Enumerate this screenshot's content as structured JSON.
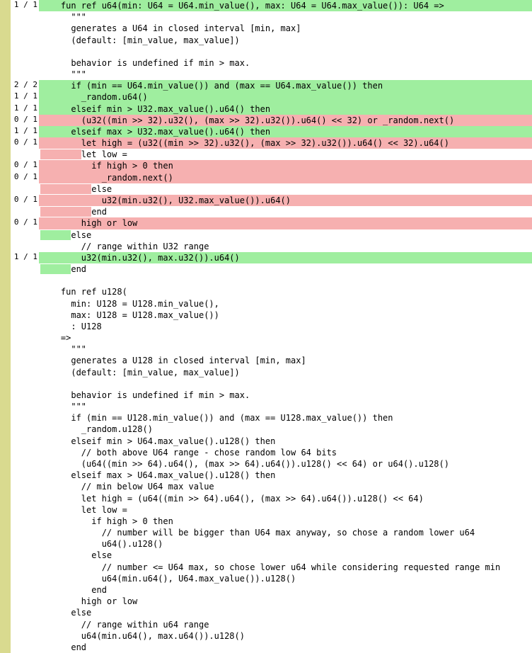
{
  "lines": [
    {
      "cov": "1 / 1",
      "hl": "green",
      "text": "    fun ref u64(min: U64 = U64.min_value(), max: U64 = U64.max_value()): U64 =>"
    },
    {
      "cov": "",
      "hl": "none",
      "text": "      \"\"\""
    },
    {
      "cov": "",
      "hl": "none",
      "text": "      generates a U64 in closed interval [min, max]"
    },
    {
      "cov": "",
      "hl": "none",
      "text": "      (default: [min_value, max_value])"
    },
    {
      "cov": "",
      "hl": "none",
      "text": ""
    },
    {
      "cov": "",
      "hl": "none",
      "text": "      behavior is undefined if min > max."
    },
    {
      "cov": "",
      "hl": "none",
      "text": "      \"\"\""
    },
    {
      "cov": "2 / 2",
      "hl": "green",
      "text": "      if (min == U64.min_value()) and (max == U64.max_value()) then"
    },
    {
      "cov": "1 / 1",
      "hl": "green",
      "text": "        _random.u64()"
    },
    {
      "cov": "1 / 1",
      "hl": "green",
      "text": "      elseif min > U32.max_value().u64() then"
    },
    {
      "cov": "0 / 1",
      "hl": "red",
      "text": "        (u32((min >> 32).u32(), (max >> 32).u32()).u64() << 32) or _random.next()"
    },
    {
      "cov": "1 / 1",
      "hl": "green",
      "text": "      elseif max > U32.max_value().u64() then"
    },
    {
      "cov": "0 / 1",
      "hl": "red",
      "text": "        let high = (u32((min >> 32).u32(), (max >> 32).u32()).u64() << 32).u64()"
    },
    {
      "cov": "",
      "hl": "mix-red",
      "indent": 8,
      "text": "let low ="
    },
    {
      "cov": "0 / 1",
      "hl": "red",
      "text": "          if high > 0 then"
    },
    {
      "cov": "0 / 1",
      "hl": "red",
      "text": "            _random.next()"
    },
    {
      "cov": "",
      "hl": "mix-red",
      "indent": 10,
      "text": "else"
    },
    {
      "cov": "0 / 1",
      "hl": "red",
      "text": "            u32(min.u32(), U32.max_value()).u64()"
    },
    {
      "cov": "",
      "hl": "mix-red",
      "indent": 10,
      "text": "end"
    },
    {
      "cov": "0 / 1",
      "hl": "red",
      "text": "        high or low"
    },
    {
      "cov": "",
      "hl": "mix-green",
      "indent": 6,
      "text": "else"
    },
    {
      "cov": "",
      "hl": "none",
      "text": "        // range within U32 range"
    },
    {
      "cov": "1 / 1",
      "hl": "green",
      "text": "        u32(min.u32(), max.u32()).u64()"
    },
    {
      "cov": "",
      "hl": "mix-green",
      "indent": 6,
      "text": "end"
    },
    {
      "cov": "",
      "hl": "none",
      "text": ""
    },
    {
      "cov": "",
      "hl": "none",
      "text": "    fun ref u128("
    },
    {
      "cov": "",
      "hl": "none",
      "text": "      min: U128 = U128.min_value(),"
    },
    {
      "cov": "",
      "hl": "none",
      "text": "      max: U128 = U128.max_value())"
    },
    {
      "cov": "",
      "hl": "none",
      "text": "      : U128"
    },
    {
      "cov": "",
      "hl": "none",
      "text": "    =>"
    },
    {
      "cov": "",
      "hl": "none",
      "text": "      \"\"\""
    },
    {
      "cov": "",
      "hl": "none",
      "text": "      generates a U128 in closed interval [min, max]"
    },
    {
      "cov": "",
      "hl": "none",
      "text": "      (default: [min_value, max_value])"
    },
    {
      "cov": "",
      "hl": "none",
      "text": ""
    },
    {
      "cov": "",
      "hl": "none",
      "text": "      behavior is undefined if min > max."
    },
    {
      "cov": "",
      "hl": "none",
      "text": "      \"\"\""
    },
    {
      "cov": "",
      "hl": "none",
      "text": "      if (min == U128.min_value()) and (max == U128.max_value()) then"
    },
    {
      "cov": "",
      "hl": "none",
      "text": "        _random.u128()"
    },
    {
      "cov": "",
      "hl": "none",
      "text": "      elseif min > U64.max_value().u128() then"
    },
    {
      "cov": "",
      "hl": "none",
      "text": "        // both above U64 range - chose random low 64 bits"
    },
    {
      "cov": "",
      "hl": "none",
      "text": "        (u64((min >> 64).u64(), (max >> 64).u64()).u128() << 64) or u64().u128()"
    },
    {
      "cov": "",
      "hl": "none",
      "text": "      elseif max > U64.max_value().u128() then"
    },
    {
      "cov": "",
      "hl": "none",
      "text": "        // min below U64 max value"
    },
    {
      "cov": "",
      "hl": "none",
      "text": "        let high = (u64((min >> 64).u64(), (max >> 64).u64()).u128() << 64)"
    },
    {
      "cov": "",
      "hl": "none",
      "text": "        let low ="
    },
    {
      "cov": "",
      "hl": "none",
      "text": "          if high > 0 then"
    },
    {
      "cov": "",
      "hl": "none",
      "text": "            // number will be bigger than U64 max anyway, so chose a random lower u64"
    },
    {
      "cov": "",
      "hl": "none",
      "text": "            u64().u128()"
    },
    {
      "cov": "",
      "hl": "none",
      "text": "          else"
    },
    {
      "cov": "",
      "hl": "none",
      "text": "            // number <= U64 max, so chose lower u64 while considering requested range min"
    },
    {
      "cov": "",
      "hl": "none",
      "text": "            u64(min.u64(), U64.max_value()).u128()"
    },
    {
      "cov": "",
      "hl": "none",
      "text": "          end"
    },
    {
      "cov": "",
      "hl": "none",
      "text": "        high or low"
    },
    {
      "cov": "",
      "hl": "none",
      "text": "      else"
    },
    {
      "cov": "",
      "hl": "none",
      "text": "        // range within u64 range"
    },
    {
      "cov": "",
      "hl": "none",
      "text": "        u64(min.u64(), max.u64()).u128()"
    },
    {
      "cov": "",
      "hl": "none",
      "text": "      end"
    }
  ],
  "colors": {
    "gutter": "#d9da8f",
    "green": "#9fee9f",
    "red": "#f6b0b0"
  }
}
